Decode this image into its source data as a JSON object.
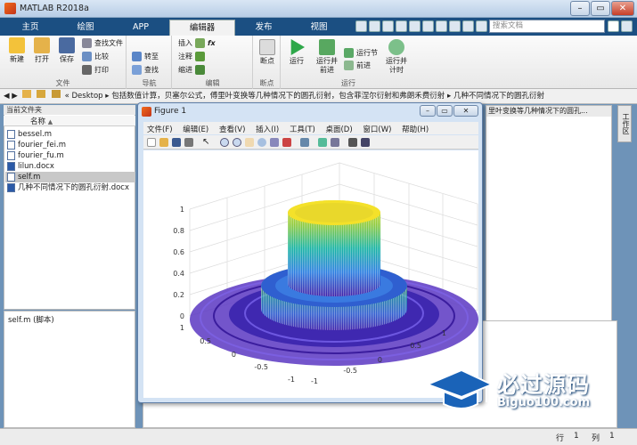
{
  "app": {
    "title": "MATLAB R2018a"
  },
  "tabs": [
    {
      "label": "主页"
    },
    {
      "label": "绘图"
    },
    {
      "label": "APP"
    },
    {
      "label": "编辑器"
    },
    {
      "label": "发布"
    },
    {
      "label": "视图"
    }
  ],
  "search": {
    "placeholder": "搜索文档"
  },
  "ribbon": {
    "file": {
      "group": "文件",
      "new": "新建",
      "open": "打开",
      "save": "保存",
      "find_files": "查找文件",
      "compare": "比较",
      "print": "打印"
    },
    "nav": {
      "group": "导航",
      "goto": "转至",
      "find": "查找"
    },
    "edit": {
      "group": "编辑",
      "insert": "插入",
      "fx": "fx",
      "comment": "注释",
      "indent": "缩进"
    },
    "breakpoints": {
      "group": "断点",
      "label": "断点"
    },
    "run": {
      "group": "运行",
      "run": "运行",
      "run_advance_1": "运行并",
      "run_advance_2": "前进",
      "run_section": "运行节",
      "advance": "前进",
      "run_time_1": "运行并",
      "run_time_2": "计时"
    }
  },
  "address": {
    "path": [
      "Desktop",
      "包括数值计算，贝塞尔公式，傅里叶变换等几种情况下的圆孔衍射，包含菲涅尔衍射和弗朗禾费衍射",
      "几种不同情况下的圆孔衍射"
    ]
  },
  "current_folder": {
    "header": "当前文件夹",
    "column_name": "名称",
    "sort_arrow": "▲",
    "files": [
      {
        "name": "bessel.m"
      },
      {
        "name": "fourier_fei.m"
      },
      {
        "name": "fourier_fu.m"
      },
      {
        "name": "lilun.docx"
      },
      {
        "name": "self.m"
      },
      {
        "name": "几种不同情况下的圆孔衍射.docx"
      }
    ],
    "selected": "self.m"
  },
  "details": {
    "label": "self.m  (脚本)"
  },
  "right_panel": {
    "header": "里叶变换等几种情况下的圆孔..."
  },
  "side_tab": {
    "label": "工作区"
  },
  "figure": {
    "title": "Figure 1",
    "menu": [
      "文件(F)",
      "编辑(E)",
      "查看(V)",
      "插入(I)",
      "工具(T)",
      "桌面(D)",
      "窗口(W)",
      "帮助(H)"
    ],
    "z_ticks": [
      "1",
      "0.8",
      "0.6",
      "0.4",
      "0.2",
      "0"
    ],
    "x_ticks": [
      "1",
      "0.5",
      "0",
      "-0.5",
      "-1"
    ],
    "y_ticks": [
      "-1",
      "-0.5",
      "0",
      "0.5",
      "1"
    ]
  },
  "status": {
    "row_label": "行",
    "row_value": "1",
    "col_label": "列",
    "col_value": "1"
  },
  "watermark": {
    "cn": "必过源码",
    "en": "Biguo100.com"
  }
}
